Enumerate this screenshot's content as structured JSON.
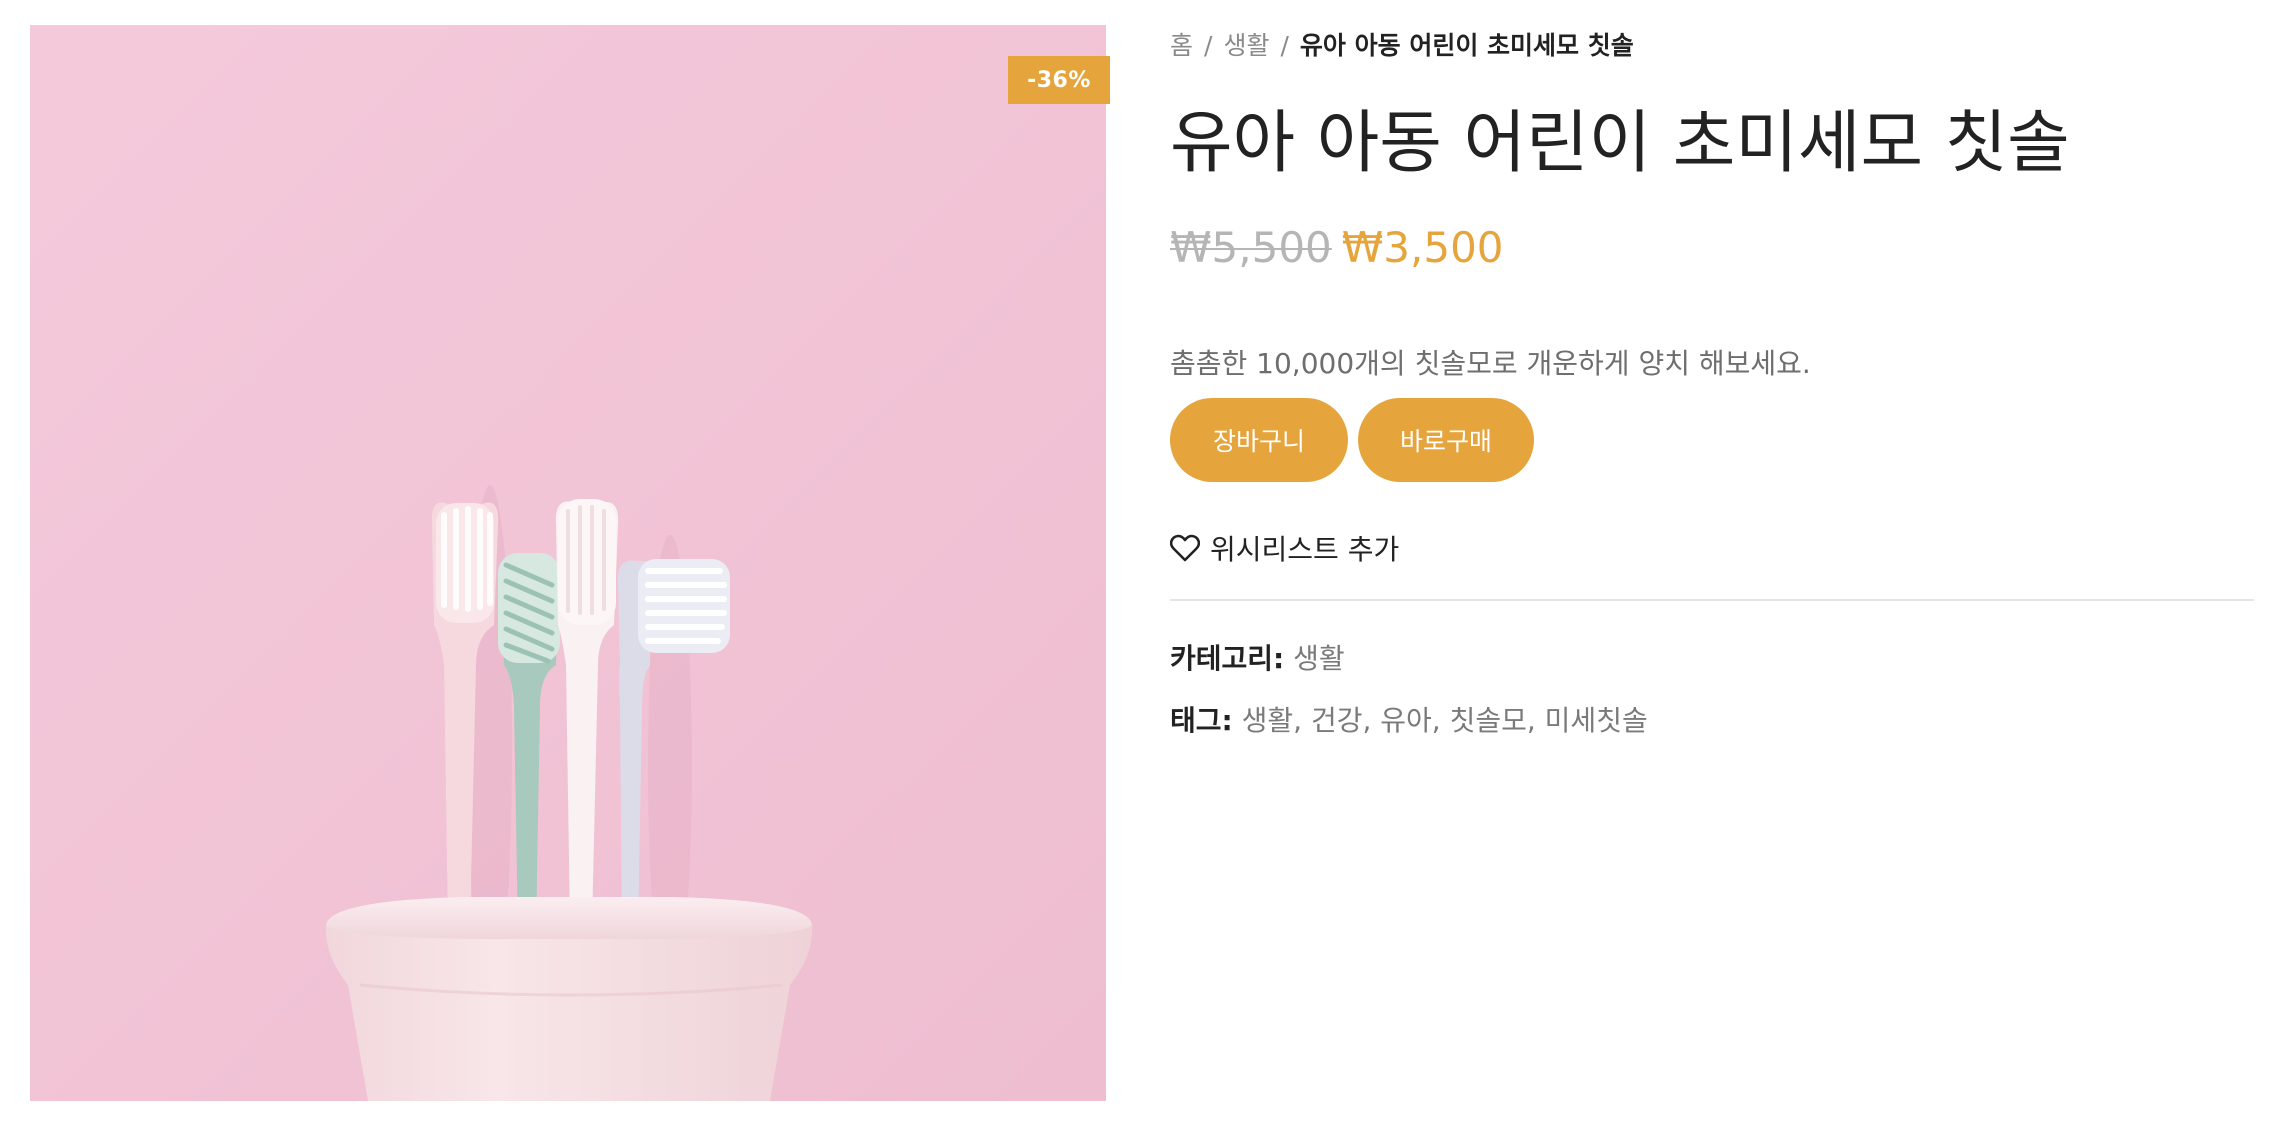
{
  "product_image": {
    "sale_badge": "-36%"
  },
  "breadcrumb": {
    "home": "홈",
    "separator": "/",
    "category": "생활",
    "current": "유아 아동 어린이 초미세모 칫솔"
  },
  "product": {
    "title": "유아 아동 어린이 초미세모 칫솔",
    "regular_price": "₩5,500",
    "sale_price": "₩3,500",
    "short_description": "촘촘한 10,000개의 칫솔모로 개운하게 양치 해보세요."
  },
  "actions": {
    "add_to_cart_label": "장바구니",
    "buy_now_label": "바로구매",
    "wishlist_label": "위시리스트 추가",
    "wishlist_icon": "heart-icon"
  },
  "meta": {
    "category_label": "카테고리:",
    "category_value": "생활",
    "tags_label": "태그:",
    "tags_value": "생활, 건강, 유아, 칫솔모, 미세칫솔"
  },
  "colors": {
    "accent": "#e6a43c",
    "image_background": "#f2c6d8",
    "price_regular": "#b5b5b5",
    "text_dark": "#222222",
    "text_muted": "#7a7a7a"
  }
}
